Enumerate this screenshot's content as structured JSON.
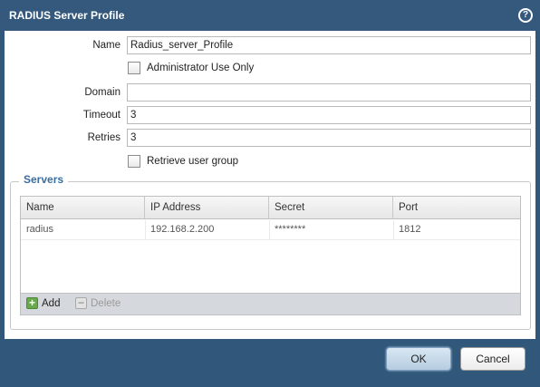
{
  "dialog": {
    "title": "RADIUS Server Profile",
    "help_glyph": "?"
  },
  "form": {
    "name_label": "Name",
    "name_value": "Radius_server_Profile",
    "admin_only_label": "Administrator Use Only",
    "domain_label": "Domain",
    "domain_value": "",
    "timeout_label": "Timeout",
    "timeout_value": "3",
    "retries_label": "Retries",
    "retries_value": "3",
    "retrieve_group_label": "Retrieve user group"
  },
  "servers": {
    "legend": "Servers",
    "columns": [
      "Name",
      "IP Address",
      "Secret",
      "Port"
    ],
    "rows": [
      [
        "radius",
        "192.168.2.200",
        "********",
        "1812"
      ]
    ],
    "add_label": "Add",
    "delete_label": "Delete"
  },
  "buttons": {
    "ok": "OK",
    "cancel": "Cancel"
  },
  "colors": {
    "titlebar": "#34597d",
    "legend": "#3a6da0",
    "add_icon": "#6aa84f"
  }
}
